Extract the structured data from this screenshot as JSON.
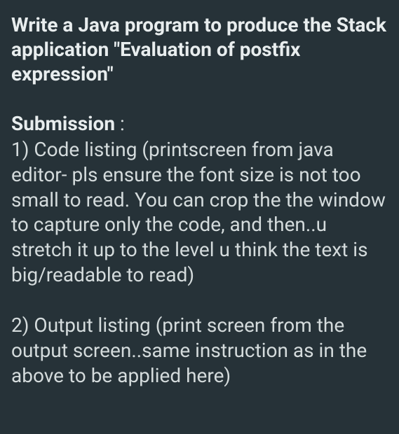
{
  "title": "Write a Java program to produce the Stack application \"Evaluation of postfix expression\"",
  "submission": {
    "label": "Submission",
    "colon": " :"
  },
  "item1": "1) Code listing (printscreen from java editor- pls ensure the font size is not too small to read. You can crop the the window to capture only the code, and then..u stretch it up to the level u think the text is big/readable to read)",
  "item2": "2) Output listing (print screen from the output screen..same instruction as in the above to be applied here)"
}
